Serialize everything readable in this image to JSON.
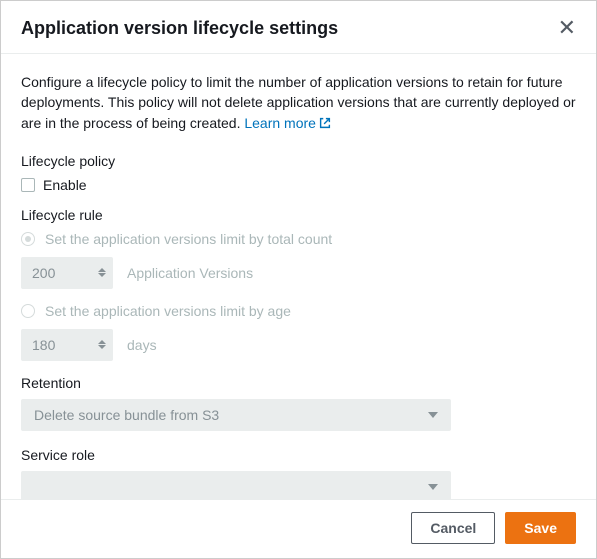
{
  "header": {
    "title": "Application version lifecycle settings",
    "close_glyph": "✕"
  },
  "description": {
    "text": "Configure a lifecycle policy to limit the number of application versions to retain for future deployments. This policy will not delete application versions that are currently deployed or are in the process of being created. ",
    "learn_more": "Learn more"
  },
  "lifecycle_policy": {
    "label": "Lifecycle policy",
    "enable_label": "Enable",
    "enabled": false
  },
  "lifecycle_rule": {
    "label": "Lifecycle rule",
    "by_count": {
      "label": "Set the application versions limit by total count",
      "value": "200",
      "unit": "Application Versions",
      "selected": true
    },
    "by_age": {
      "label": "Set the application versions limit by age",
      "value": "180",
      "unit": "days",
      "selected": false
    }
  },
  "retention": {
    "label": "Retention",
    "selected": "Delete source bundle from S3"
  },
  "service_role": {
    "label": "Service role",
    "selected": ""
  },
  "footer": {
    "cancel": "Cancel",
    "save": "Save"
  }
}
